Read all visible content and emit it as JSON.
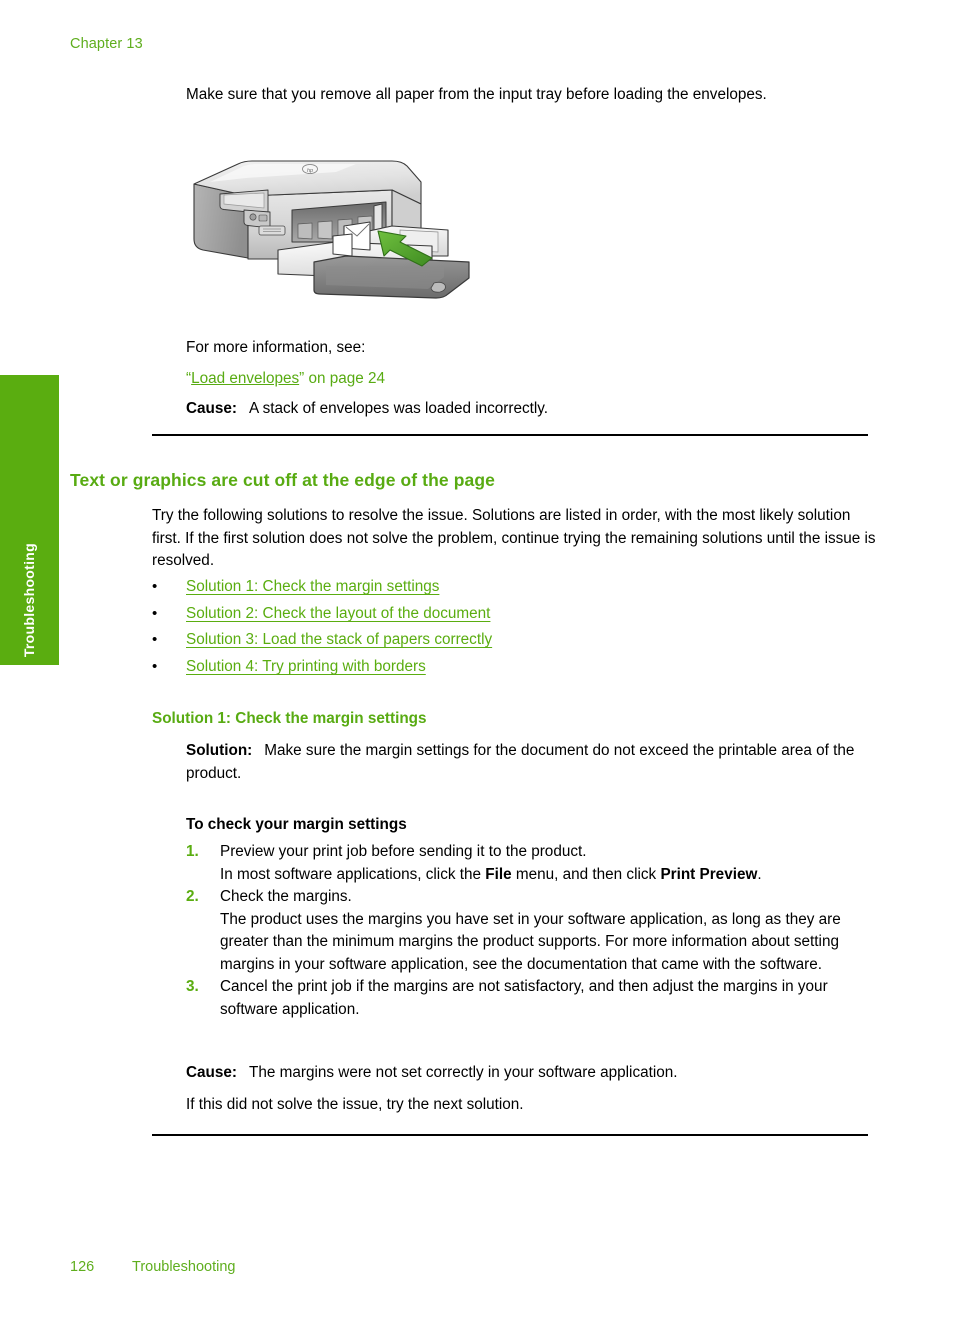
{
  "page": {
    "chapter": "Chapter 13",
    "footer_page_number": "126",
    "footer_section": "Troubleshooting",
    "side_tab_label": "Troubleshooting",
    "accent_green": "#5aad10",
    "header_green": "#5fae1e",
    "link_green": "#5aad10",
    "text_black": "#000000"
  },
  "intro": {
    "paragraph": "Make sure that you remove all paper from the input tray before loading the envelopes."
  },
  "figure": {
    "name": "hp-all-in-one-printer-loading-envelopes",
    "caption": "",
    "arrow_color": "#4da32c",
    "body_color": "#d9d9d9",
    "brand_mark": "hp"
  },
  "see_also": {
    "lead_in": "For more information, see:",
    "link_open_quote": "“",
    "link_text": "Load envelopes",
    "link_close_quote": "”",
    "link_suffix": " on page 24"
  },
  "cause_first": {
    "label": "Cause:",
    "text": "A stack of envelopes was loaded incorrectly."
  },
  "section": {
    "heading": "Text or graphics are cut off at the edge of the page",
    "intro": "Try the following solutions to resolve the issue. Solutions are listed in order, with the most likely solution first. If the first solution does not solve the problem, continue trying the remaining solutions until the issue is resolved.",
    "bullet_mark": "•",
    "links": [
      "Solution 1: Check the margin settings",
      "Solution 2: Check the layout of the document",
      "Solution 3: Load the stack of papers correctly",
      "Solution 4: Try printing with borders"
    ]
  },
  "solution_1": {
    "heading": "Solution 1: Check the margin settings",
    "solution_label": "Solution:",
    "solution_text": "Make sure the margin settings for the document do not exceed the printable area of the product.",
    "procedure_heading": "To check your margin settings",
    "steps": [
      {
        "number": "1.",
        "line1": "Preview your print job before sending it to the product.",
        "line2_prefix": "In most software applications, click the ",
        "line2_bold1": "File",
        "line2_middle": " menu, and then click ",
        "line2_bold2": "Print Preview",
        "line2_suffix": "."
      },
      {
        "number": "2.",
        "line1": "Check the margins.",
        "line2_prefix": "The product uses the margins you have set in your software application, as long as they are greater than the minimum margins the product supports. For more information about setting margins in your software application, see the documentation that came with the software.",
        "line2_bold1": "",
        "line2_middle": "",
        "line2_bold2": "",
        "line2_suffix": ""
      },
      {
        "number": "3.",
        "line1": "Cancel the print job if the margins are not satisfactory, and then adjust the margins in your software application.",
        "line2_prefix": "",
        "line2_bold1": "",
        "line2_middle": "",
        "line2_bold2": "",
        "line2_suffix": ""
      }
    ],
    "cause_label": "Cause:",
    "cause_text": "The margins were not set correctly in your software application.",
    "next_text": "If this did not solve the issue, try the next solution."
  }
}
